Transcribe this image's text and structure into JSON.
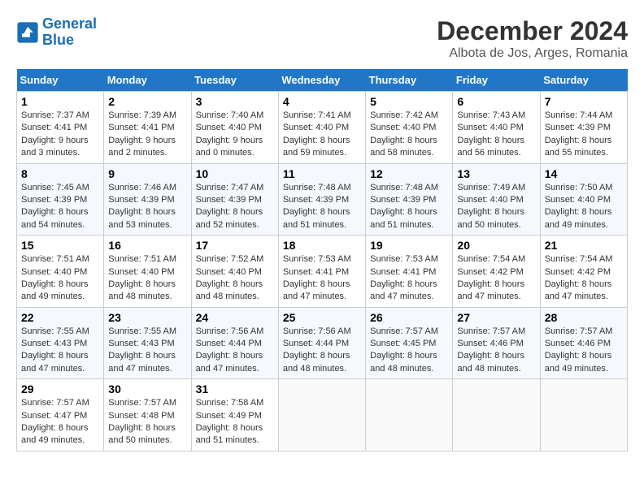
{
  "header": {
    "logo_line1": "General",
    "logo_line2": "Blue",
    "month": "December 2024",
    "location": "Albota de Jos, Arges, Romania"
  },
  "days_of_week": [
    "Sunday",
    "Monday",
    "Tuesday",
    "Wednesday",
    "Thursday",
    "Friday",
    "Saturday"
  ],
  "weeks": [
    [
      {
        "day": "1",
        "sunrise": "7:37 AM",
        "sunset": "4:41 PM",
        "daylight": "9 hours and 3 minutes."
      },
      {
        "day": "2",
        "sunrise": "7:39 AM",
        "sunset": "4:41 PM",
        "daylight": "9 hours and 2 minutes."
      },
      {
        "day": "3",
        "sunrise": "7:40 AM",
        "sunset": "4:40 PM",
        "daylight": "9 hours and 0 minutes."
      },
      {
        "day": "4",
        "sunrise": "7:41 AM",
        "sunset": "4:40 PM",
        "daylight": "8 hours and 59 minutes."
      },
      {
        "day": "5",
        "sunrise": "7:42 AM",
        "sunset": "4:40 PM",
        "daylight": "8 hours and 58 minutes."
      },
      {
        "day": "6",
        "sunrise": "7:43 AM",
        "sunset": "4:40 PM",
        "daylight": "8 hours and 56 minutes."
      },
      {
        "day": "7",
        "sunrise": "7:44 AM",
        "sunset": "4:39 PM",
        "daylight": "8 hours and 55 minutes."
      }
    ],
    [
      {
        "day": "8",
        "sunrise": "7:45 AM",
        "sunset": "4:39 PM",
        "daylight": "8 hours and 54 minutes."
      },
      {
        "day": "9",
        "sunrise": "7:46 AM",
        "sunset": "4:39 PM",
        "daylight": "8 hours and 53 minutes."
      },
      {
        "day": "10",
        "sunrise": "7:47 AM",
        "sunset": "4:39 PM",
        "daylight": "8 hours and 52 minutes."
      },
      {
        "day": "11",
        "sunrise": "7:48 AM",
        "sunset": "4:39 PM",
        "daylight": "8 hours and 51 minutes."
      },
      {
        "day": "12",
        "sunrise": "7:48 AM",
        "sunset": "4:39 PM",
        "daylight": "8 hours and 51 minutes."
      },
      {
        "day": "13",
        "sunrise": "7:49 AM",
        "sunset": "4:40 PM",
        "daylight": "8 hours and 50 minutes."
      },
      {
        "day": "14",
        "sunrise": "7:50 AM",
        "sunset": "4:40 PM",
        "daylight": "8 hours and 49 minutes."
      }
    ],
    [
      {
        "day": "15",
        "sunrise": "7:51 AM",
        "sunset": "4:40 PM",
        "daylight": "8 hours and 49 minutes."
      },
      {
        "day": "16",
        "sunrise": "7:51 AM",
        "sunset": "4:40 PM",
        "daylight": "8 hours and 48 minutes."
      },
      {
        "day": "17",
        "sunrise": "7:52 AM",
        "sunset": "4:40 PM",
        "daylight": "8 hours and 48 minutes."
      },
      {
        "day": "18",
        "sunrise": "7:53 AM",
        "sunset": "4:41 PM",
        "daylight": "8 hours and 47 minutes."
      },
      {
        "day": "19",
        "sunrise": "7:53 AM",
        "sunset": "4:41 PM",
        "daylight": "8 hours and 47 minutes."
      },
      {
        "day": "20",
        "sunrise": "7:54 AM",
        "sunset": "4:42 PM",
        "daylight": "8 hours and 47 minutes."
      },
      {
        "day": "21",
        "sunrise": "7:54 AM",
        "sunset": "4:42 PM",
        "daylight": "8 hours and 47 minutes."
      }
    ],
    [
      {
        "day": "22",
        "sunrise": "7:55 AM",
        "sunset": "4:43 PM",
        "daylight": "8 hours and 47 minutes."
      },
      {
        "day": "23",
        "sunrise": "7:55 AM",
        "sunset": "4:43 PM",
        "daylight": "8 hours and 47 minutes."
      },
      {
        "day": "24",
        "sunrise": "7:56 AM",
        "sunset": "4:44 PM",
        "daylight": "8 hours and 47 minutes."
      },
      {
        "day": "25",
        "sunrise": "7:56 AM",
        "sunset": "4:44 PM",
        "daylight": "8 hours and 48 minutes."
      },
      {
        "day": "26",
        "sunrise": "7:57 AM",
        "sunset": "4:45 PM",
        "daylight": "8 hours and 48 minutes."
      },
      {
        "day": "27",
        "sunrise": "7:57 AM",
        "sunset": "4:46 PM",
        "daylight": "8 hours and 48 minutes."
      },
      {
        "day": "28",
        "sunrise": "7:57 AM",
        "sunset": "4:46 PM",
        "daylight": "8 hours and 49 minutes."
      }
    ],
    [
      {
        "day": "29",
        "sunrise": "7:57 AM",
        "sunset": "4:47 PM",
        "daylight": "8 hours and 49 minutes."
      },
      {
        "day": "30",
        "sunrise": "7:57 AM",
        "sunset": "4:48 PM",
        "daylight": "8 hours and 50 minutes."
      },
      {
        "day": "31",
        "sunrise": "7:58 AM",
        "sunset": "4:49 PM",
        "daylight": "8 hours and 51 minutes."
      },
      null,
      null,
      null,
      null
    ]
  ],
  "label_sunrise": "Sunrise:",
  "label_sunset": "Sunset:",
  "label_daylight": "Daylight:"
}
